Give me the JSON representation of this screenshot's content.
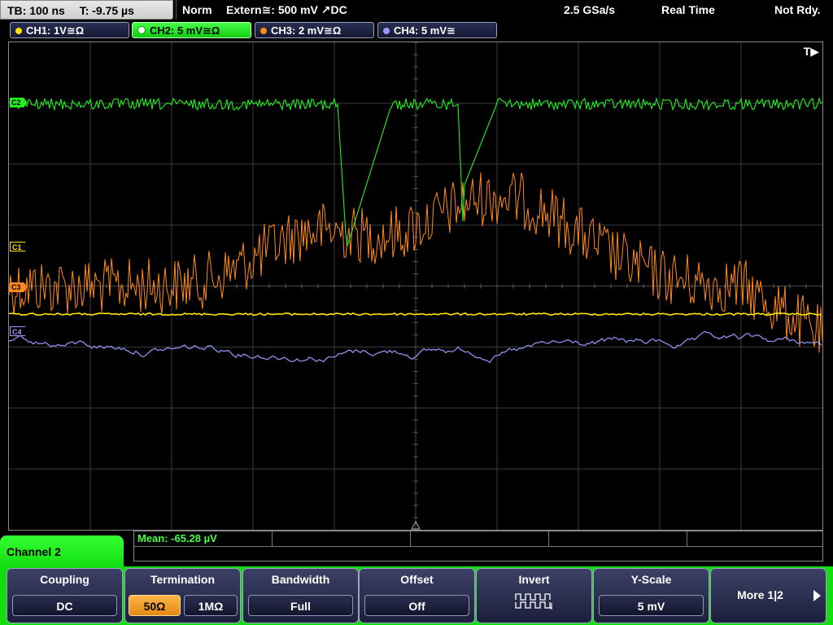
{
  "status_bar": {
    "timebase": "TB: 100 ns",
    "trigger_time": "T: -9.75 µs",
    "trigger_mode": "Norm",
    "trigger_source": "Extern≅: 500 mV ↗DC",
    "sample_rate": "2.5 GSa/s",
    "acq_mode": "Real Time",
    "run_status": "Not Rdy."
  },
  "channels": [
    {
      "label": "CH1: 1V≅Ω",
      "color": "#ffe600",
      "active": false
    },
    {
      "label": "CH2: 5 mV≅Ω",
      "color": "#22ee22",
      "active": true
    },
    {
      "label": "CH3: 2 mV≅Ω",
      "color": "#ff8a1e",
      "active": false
    },
    {
      "label": "CH4: 5 mV≅",
      "color": "#9a9aff",
      "active": false
    }
  ],
  "markers": {
    "c1": "C1",
    "c2": "C2",
    "c3": "C3",
    "c4": "C4",
    "trigger": "T▶"
  },
  "measurement": {
    "mean": "Mean: -65.28 µV"
  },
  "menu": {
    "title": "Channel 2",
    "coupling": {
      "label": "Coupling",
      "value": "DC"
    },
    "termination": {
      "label": "Termination",
      "opt1": "50Ω",
      "opt2": "1MΩ"
    },
    "bandwidth": {
      "label": "Bandwidth",
      "value": "Full"
    },
    "offset": {
      "label": "Offset",
      "value": "Off"
    },
    "invert": {
      "label": "Invert",
      "icon": "pulse-invert-icon"
    },
    "yscale": {
      "label": "Y-Scale",
      "value": "5 mV"
    },
    "more": {
      "label": "More 1|2"
    }
  },
  "colors": {
    "ch1": "#ffe600",
    "ch2": "#22ee22",
    "ch3": "#ff8a1e",
    "ch4": "#9a9aff",
    "accent_green": "#11dd11",
    "selected_orange": "#f0a030",
    "grid": "#3c3c3c"
  }
}
